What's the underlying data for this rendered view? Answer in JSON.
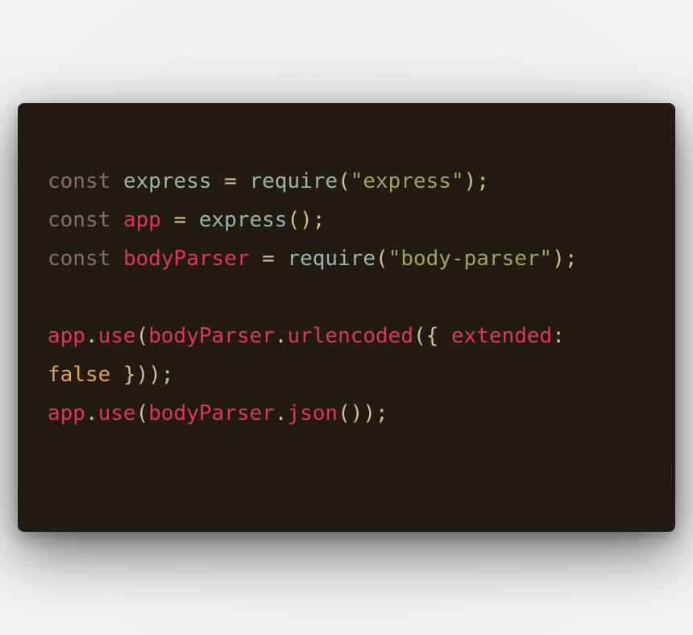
{
  "colors": {
    "keyword": "#8d6a6a",
    "identifier": "#93b7b3",
    "variable": "#e0355b",
    "string": "#9aa658",
    "punctuation": "#d9bf8b",
    "boolean": "#e8a04b",
    "background": "#221b11"
  },
  "code": {
    "lines": [
      [
        {
          "text": "const",
          "kind": "keyword"
        },
        {
          "text": " ",
          "kind": "punctuation"
        },
        {
          "text": "express",
          "kind": "identifier"
        },
        {
          "text": " = ",
          "kind": "punctuation"
        },
        {
          "text": "require",
          "kind": "identifier"
        },
        {
          "text": "(",
          "kind": "punctuation"
        },
        {
          "text": "\"express\"",
          "kind": "string"
        },
        {
          "text": ");",
          "kind": "punctuation"
        }
      ],
      [
        {
          "text": "const",
          "kind": "keyword"
        },
        {
          "text": " ",
          "kind": "punctuation"
        },
        {
          "text": "app",
          "kind": "variable"
        },
        {
          "text": " = ",
          "kind": "punctuation"
        },
        {
          "text": "express",
          "kind": "identifier"
        },
        {
          "text": "();",
          "kind": "punctuation"
        }
      ],
      [
        {
          "text": "const",
          "kind": "keyword"
        },
        {
          "text": " ",
          "kind": "punctuation"
        },
        {
          "text": "bodyParser",
          "kind": "variable"
        },
        {
          "text": " = ",
          "kind": "punctuation"
        },
        {
          "text": "require",
          "kind": "identifier"
        },
        {
          "text": "(",
          "kind": "punctuation"
        },
        {
          "text": "\"body-parser\"",
          "kind": "string"
        },
        {
          "text": ");",
          "kind": "punctuation"
        }
      ],
      [],
      [
        {
          "text": "app",
          "kind": "variable"
        },
        {
          "text": ".",
          "kind": "punctuation"
        },
        {
          "text": "use",
          "kind": "variable"
        },
        {
          "text": "(",
          "kind": "punctuation"
        },
        {
          "text": "bodyParser",
          "kind": "variable"
        },
        {
          "text": ".",
          "kind": "punctuation"
        },
        {
          "text": "urlencoded",
          "kind": "variable"
        },
        {
          "text": "({ ",
          "kind": "punctuation"
        },
        {
          "text": "extended",
          "kind": "variable"
        },
        {
          "text": ":",
          "kind": "punctuation"
        }
      ],
      [
        {
          "text": "false",
          "kind": "boolean"
        },
        {
          "text": " }));",
          "kind": "punctuation"
        }
      ],
      [
        {
          "text": "app",
          "kind": "variable"
        },
        {
          "text": ".",
          "kind": "punctuation"
        },
        {
          "text": "use",
          "kind": "variable"
        },
        {
          "text": "(",
          "kind": "punctuation"
        },
        {
          "text": "bodyParser",
          "kind": "variable"
        },
        {
          "text": ".",
          "kind": "punctuation"
        },
        {
          "text": "json",
          "kind": "variable"
        },
        {
          "text": "());",
          "kind": "punctuation"
        }
      ]
    ]
  }
}
